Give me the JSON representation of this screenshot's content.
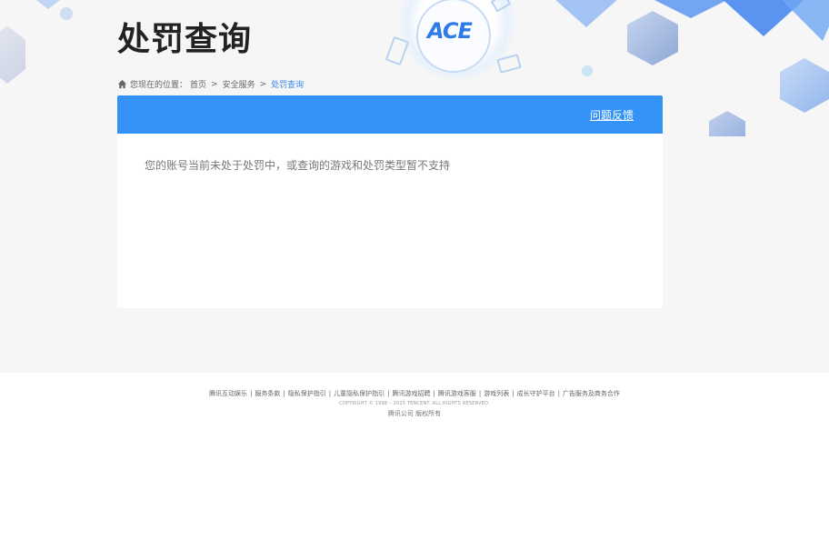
{
  "page": {
    "title": "处罚查询"
  },
  "breadcrumb": {
    "prefix": "您现在的位置：",
    "items": [
      "首页",
      "安全服务"
    ],
    "separator": ">",
    "current": "处罚查询"
  },
  "panel": {
    "feedback_label": "问题反馈",
    "message": "您的账号当前未处于处罚中，或查询的游戏和处罚类型暂不支持"
  },
  "logo": {
    "text": "ACE"
  },
  "footer": {
    "links": [
      "腾讯互动娱乐",
      "服务条款",
      "隐私保护指引",
      "儿童隐私保护指引",
      "腾讯游戏招聘",
      "腾讯游戏客服",
      "游戏列表",
      "成长守护平台",
      "广告服务及商务合作"
    ],
    "separator": "|",
    "copyright": "COPYRIGHT © 1998 – 2025 TENCENT. ALL RIGHTS RESERVED.",
    "company": "腾讯公司 版权所有"
  },
  "colors": {
    "accent": "#3593f7",
    "background": "#f6f6f6",
    "link_current": "#3a88e8"
  }
}
